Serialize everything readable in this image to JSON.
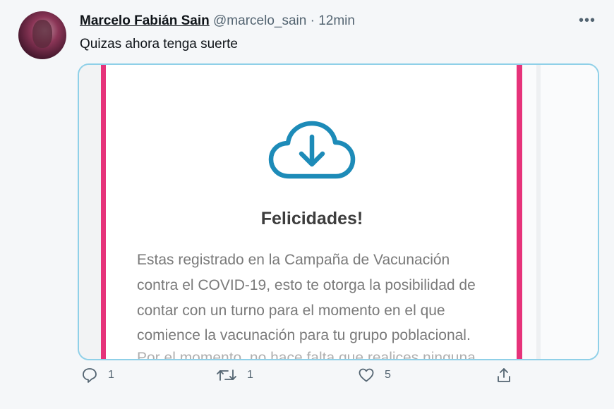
{
  "author": {
    "name": "Marcelo Fabián Sain",
    "handle": "@marcelo_sain",
    "separator": "·",
    "time": "12min"
  },
  "more_label": "•••",
  "tweet_text": "Quizas ahora tenga suerte",
  "media": {
    "icon": "cloud-download-icon",
    "heading": "Felicidades!",
    "body_lines": [
      "Estas registrado en la Campaña de Vacunación",
      "contra el COVID-19, esto te otorga la posibilidad de",
      "contar con un turno para el momento en el que",
      "comience la vacunación para tu grupo poblacional.",
      "Por el momento, no hace falta que realices ninguna"
    ],
    "accent_color": "#e6337a",
    "icon_color": "#1d8bb8"
  },
  "actions": {
    "reply": {
      "icon": "reply-icon",
      "count": "1"
    },
    "retweet": {
      "icon": "retweet-icon",
      "count": "1"
    },
    "like": {
      "icon": "heart-icon",
      "count": "5"
    },
    "share": {
      "icon": "share-icon"
    }
  }
}
